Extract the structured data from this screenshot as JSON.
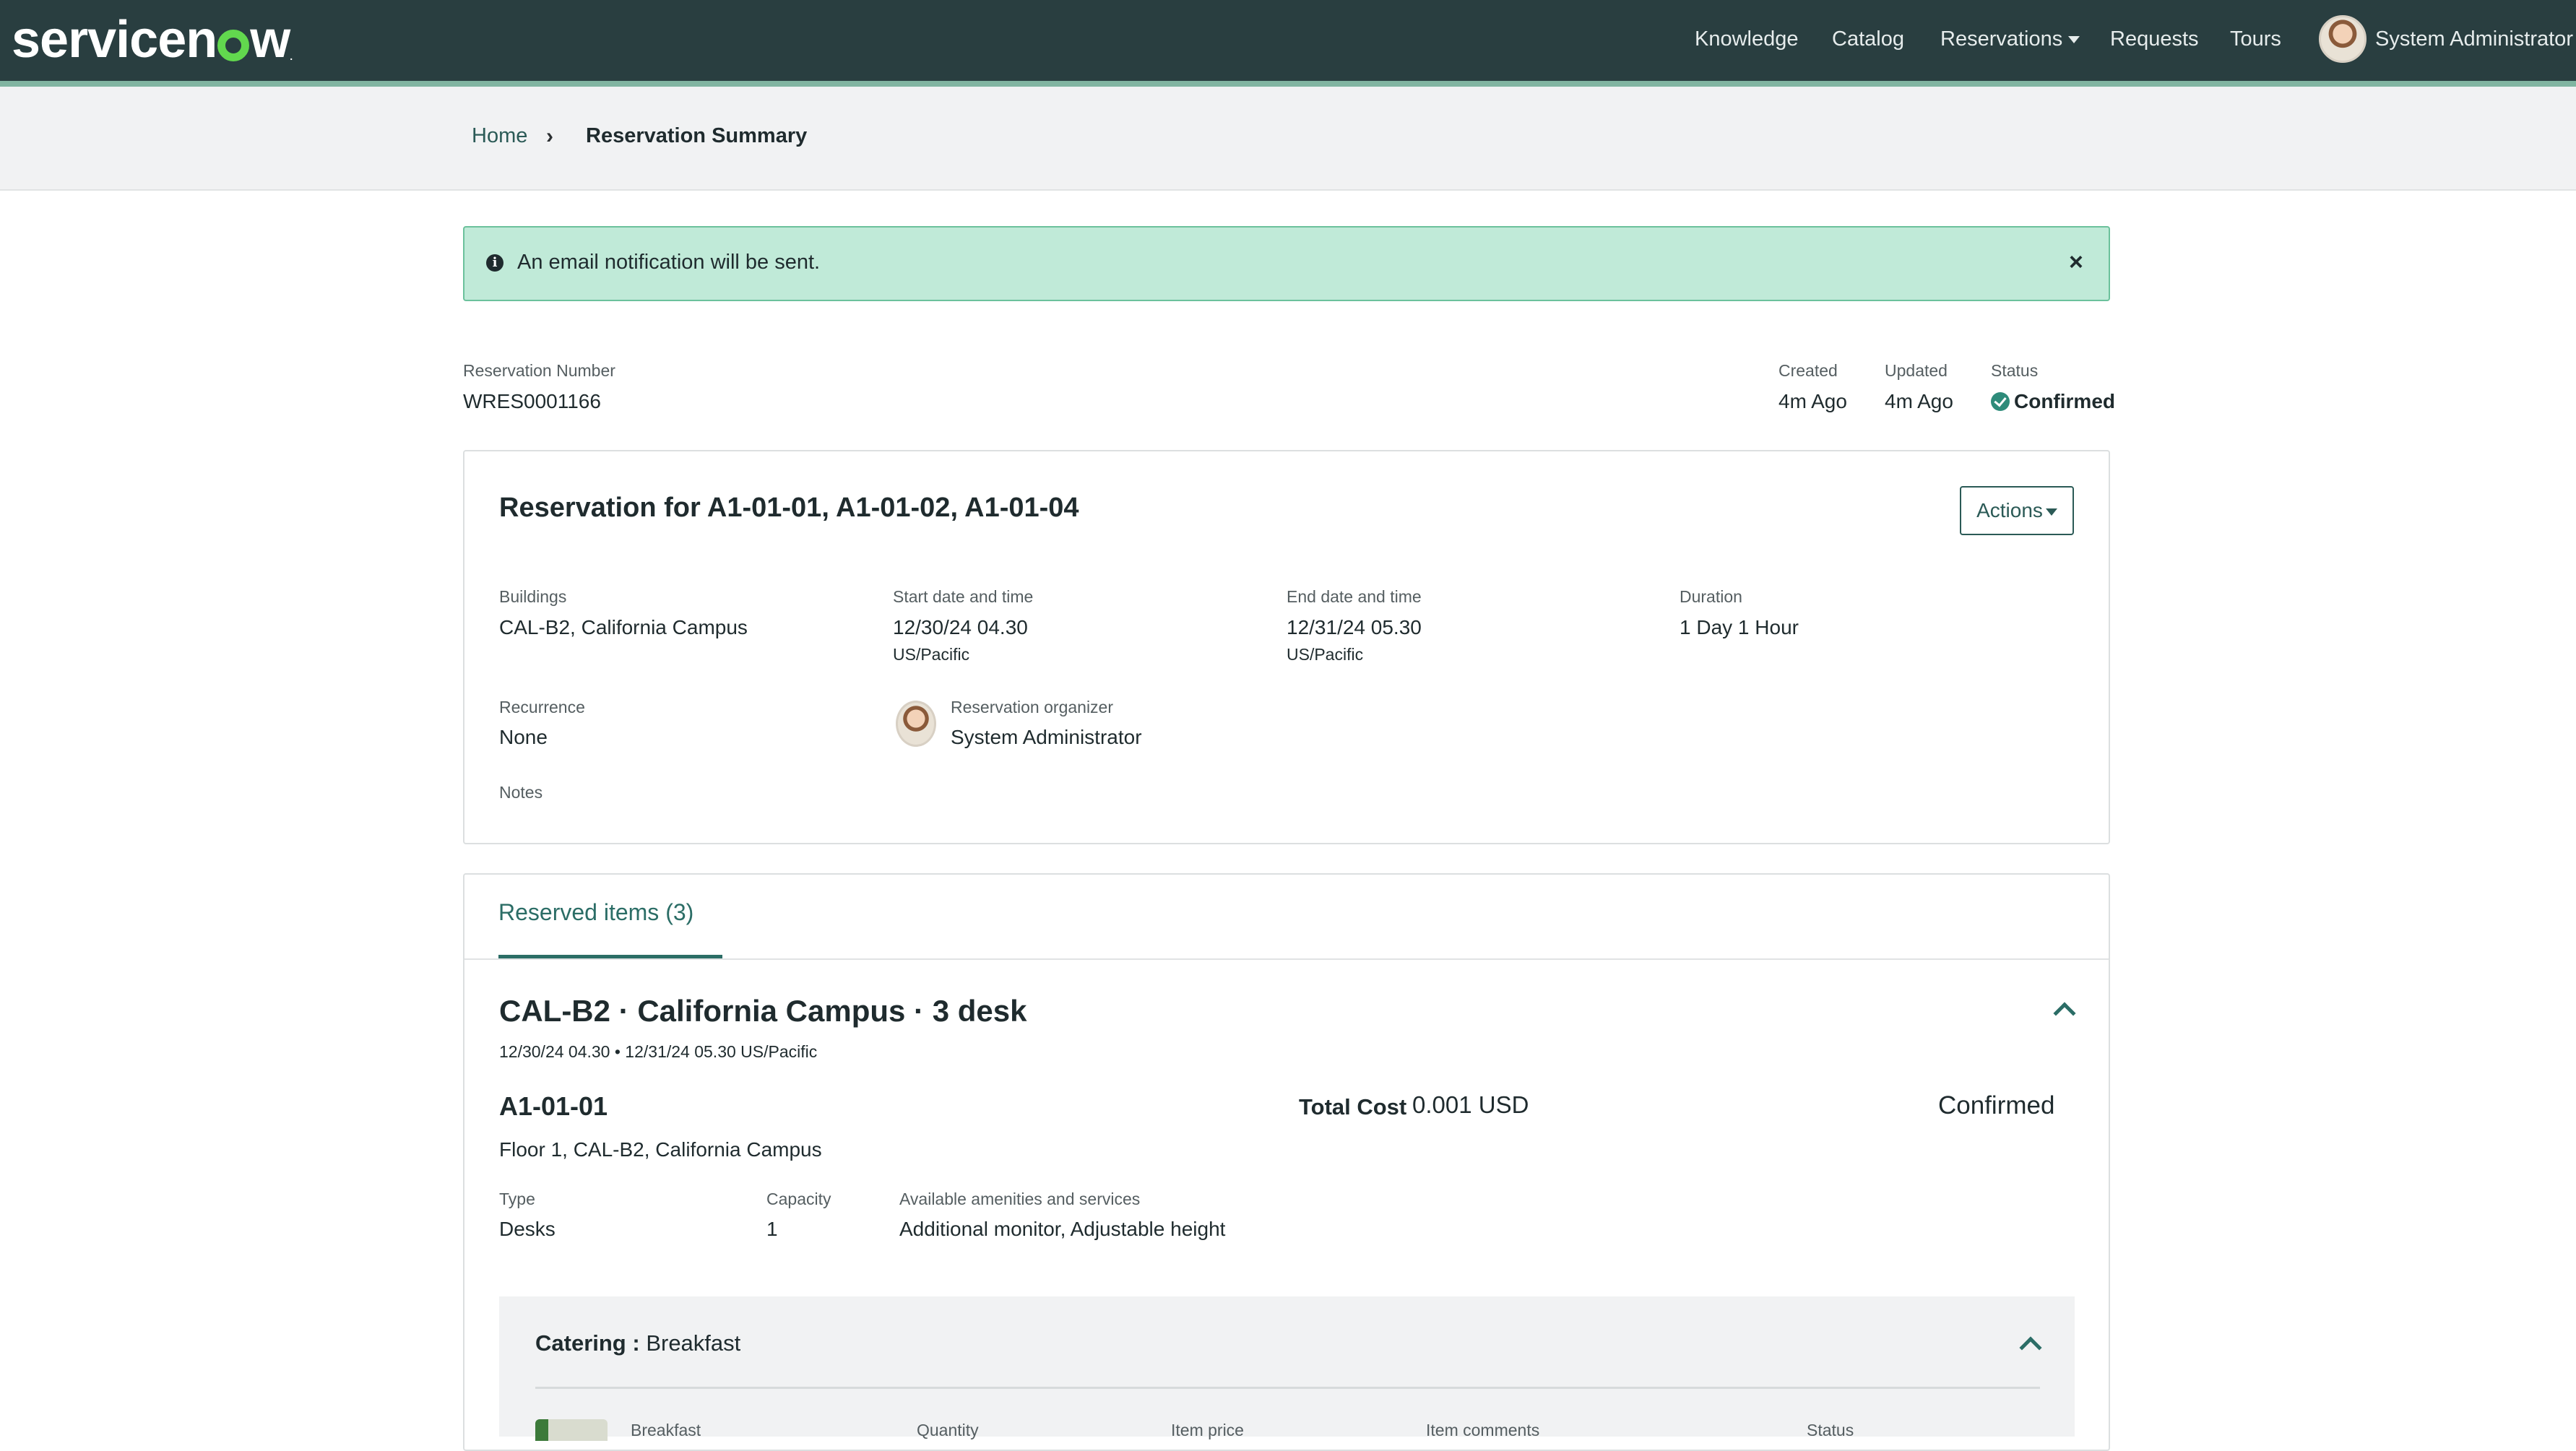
{
  "nav": {
    "logo": "servicenow",
    "links": [
      "Knowledge",
      "Catalog",
      "Reservations",
      "Requests",
      "Tours"
    ],
    "user": "System Administrator"
  },
  "breadcrumb": {
    "home": "Home",
    "separator": "›",
    "current": "Reservation Summary"
  },
  "alert": {
    "text": "An email notification will be sent.",
    "close": "×"
  },
  "reservation": {
    "number_label": "Reservation Number",
    "number": "WRES0001166",
    "created_label": "Created",
    "created": "4m Ago",
    "updated_label": "Updated",
    "updated": "4m Ago",
    "status_label": "Status",
    "status": "Confirmed"
  },
  "details": {
    "title": "Reservation for A1-01-01, A1-01-02, A1-01-04",
    "actions": "Actions",
    "buildings_label": "Buildings",
    "buildings": "CAL-B2, California Campus",
    "start_label": "Start date and time",
    "start": "12/30/24 04.30",
    "start_tz": "US/Pacific",
    "end_label": "End date and time",
    "end": "12/31/24 05.30",
    "end_tz": "US/Pacific",
    "duration_label": "Duration",
    "duration": "1 Day 1 Hour",
    "recurrence_label": "Recurrence",
    "recurrence": "None",
    "organizer_label": "Reservation organizer",
    "organizer": "System Administrator",
    "notes_label": "Notes"
  },
  "items": {
    "tab": "Reserved items (3)",
    "group_title": "CAL-B2 · California Campus · 3 desk",
    "group_sub": "12/30/24 04.30 • 12/31/24 05.30 US/Pacific",
    "item_name": "A1-01-01",
    "total_cost_label": "Total Cost",
    "total_cost": "0.001 USD",
    "item_status": "Confirmed",
    "location": "Floor 1, CAL-B2, California Campus",
    "type_label": "Type",
    "type": "Desks",
    "capacity_label": "Capacity",
    "capacity": "1",
    "amenities_label": "Available amenities and services",
    "amenities": "Additional monitor, Adjustable height"
  },
  "catering": {
    "label": "Catering :",
    "value": "Breakfast",
    "columns": [
      "Breakfast",
      "Quantity",
      "Item price",
      "Item comments",
      "Status"
    ]
  },
  "colors": {
    "nav_bg": "#293e40",
    "accent": "#2b6d66",
    "alert_bg": "#c0ead8",
    "logo_green": "#62d84e"
  }
}
